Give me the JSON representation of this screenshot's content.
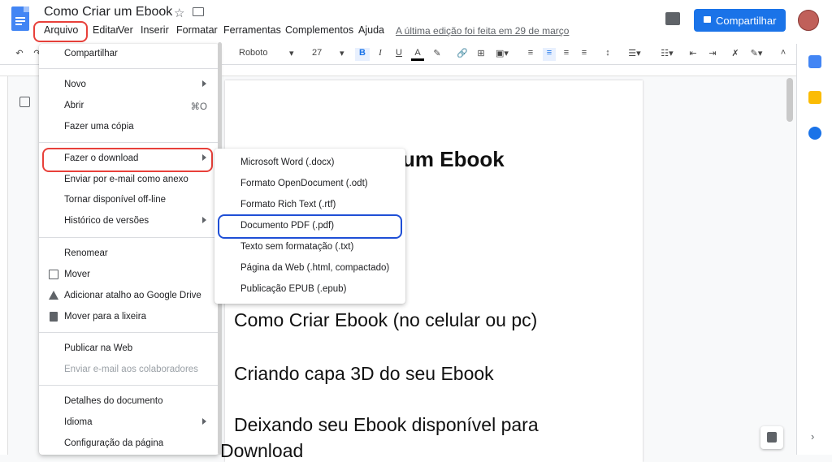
{
  "doc": {
    "title": "Como Criar um Ebook",
    "last_edit": "A última edição foi feita em 29 de março",
    "share_label": "Compartilhar"
  },
  "menubar": [
    "Arquivo",
    "Editar",
    "Ver",
    "Inserir",
    "Formatar",
    "Ferramentas",
    "Complementos",
    "Ajuda"
  ],
  "toolbar": {
    "font": "Roboto",
    "size": "27"
  },
  "file_menu": [
    {
      "label": "Compartilhar"
    },
    {
      "label": "Novo",
      "submenu": true
    },
    {
      "label": "Abrir",
      "shortcut": "⌘O"
    },
    {
      "label": "Fazer uma cópia"
    },
    {
      "label": "Fazer o download",
      "submenu": true
    },
    {
      "label": "Enviar por e-mail como anexo"
    },
    {
      "label": "Tornar disponível off-line"
    },
    {
      "label": "Histórico de versões",
      "submenu": true
    },
    {
      "label": "Renomear"
    },
    {
      "label": "Mover",
      "icon": "folder-move-icon"
    },
    {
      "label": "Adicionar atalho ao Google Drive",
      "icon": "drive-shortcut-icon"
    },
    {
      "label": "Mover para a lixeira",
      "icon": "trash-icon"
    },
    {
      "label": "Publicar na Web"
    },
    {
      "label": "Enviar e-mail aos colaboradores",
      "disabled": true
    },
    {
      "label": "Detalhes do documento"
    },
    {
      "label": "Idioma",
      "submenu": true
    },
    {
      "label": "Configuração da página"
    }
  ],
  "download_menu": [
    {
      "label": "Microsoft Word (.docx)"
    },
    {
      "label": "Formato OpenDocument (.odt)"
    },
    {
      "label": "Formato Rich Text (.rtf)"
    },
    {
      "label": "Documento PDF (.pdf)"
    },
    {
      "label": "Texto sem formatação (.txt)"
    },
    {
      "label": "Página da Web (.html, compactado)"
    },
    {
      "label": "Publicação EPUB (.epub)"
    }
  ],
  "page": {
    "heading_partial": "um Ebook",
    "lines": [
      "Como Criar Ebook (no celular ou pc)",
      "Criando capa 3D do seu Ebook",
      "Deixando seu Ebook disponível para",
      "Download"
    ]
  },
  "colors": {
    "accent": "#1a73e8",
    "highlight_red": "#e8403a",
    "highlight_blue": "#1f4fd6"
  }
}
